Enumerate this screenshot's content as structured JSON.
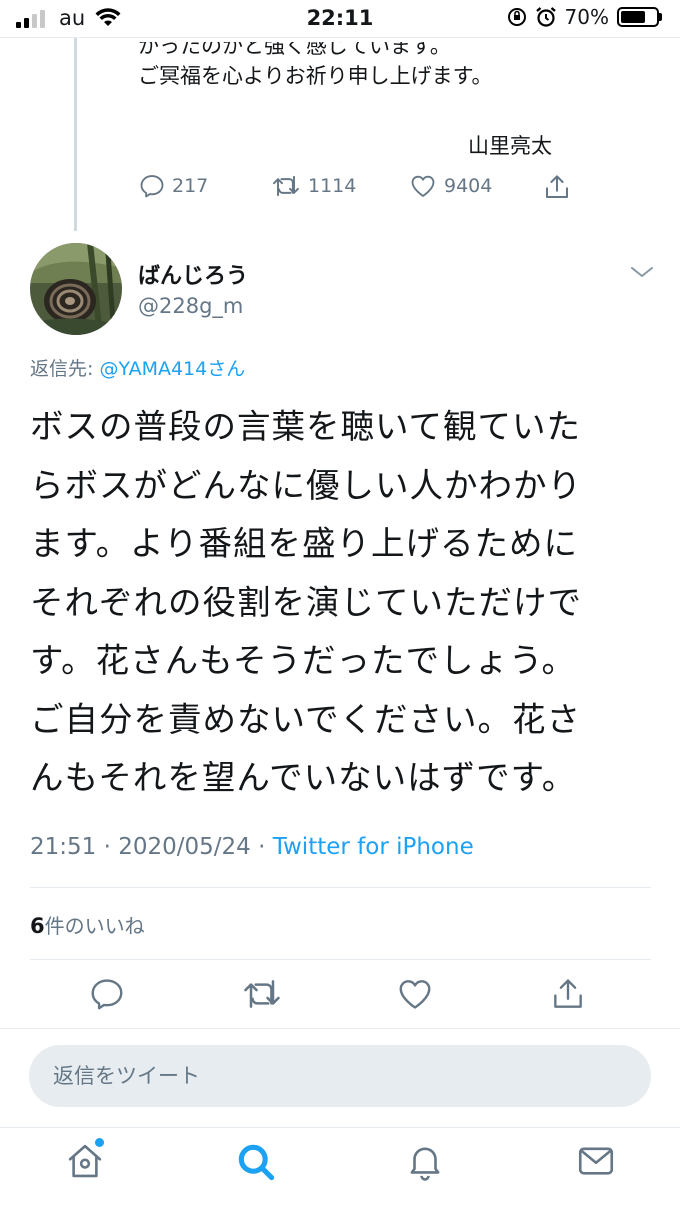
{
  "status_bar": {
    "carrier": "au",
    "time": "22:11",
    "battery": "70%"
  },
  "previous_tweet": {
    "text_line1_cut": "かったのかと強く感じています。",
    "text_line2": "ご冥福を心よりお祈り申し上げます。",
    "signature": "山里亮太",
    "reply_count": "217",
    "retweet_count": "1114",
    "like_count": "9404"
  },
  "tweet": {
    "author_name": "ばんじろう",
    "author_handle": "@228g_m",
    "reply_to_label": "返信先:",
    "reply_to_mention": "@YAMA414さん",
    "body_lines": [
      "ボスの普段の言葉を聴いて観ていた",
      "らボスがどんなに優しい人かわかり",
      "ます。より番組を盛り上げるために",
      "それぞれの役割を演じていただけで",
      "す。花さんもそうだったでしょう。",
      "ご自分を責めないでください。花さ",
      "んもそれを望んでいないはずです。"
    ],
    "time": "21:51",
    "separator": " · ",
    "date": "2020/05/24",
    "source": "Twitter for iPhone",
    "likes_count": "6",
    "likes_label": "件のいいね"
  },
  "reply_box": {
    "placeholder": "返信をツイート"
  },
  "icons": {
    "reply": "reply-icon",
    "retweet": "retweet-icon",
    "like": "heart-icon",
    "share": "share-icon",
    "home": "home-icon",
    "search": "search-icon",
    "notifications": "bell-icon",
    "messages": "mail-icon"
  },
  "colors": {
    "accent": "#1da1f2",
    "secondary_text": "#657786",
    "divider": "#e6ecf0"
  }
}
